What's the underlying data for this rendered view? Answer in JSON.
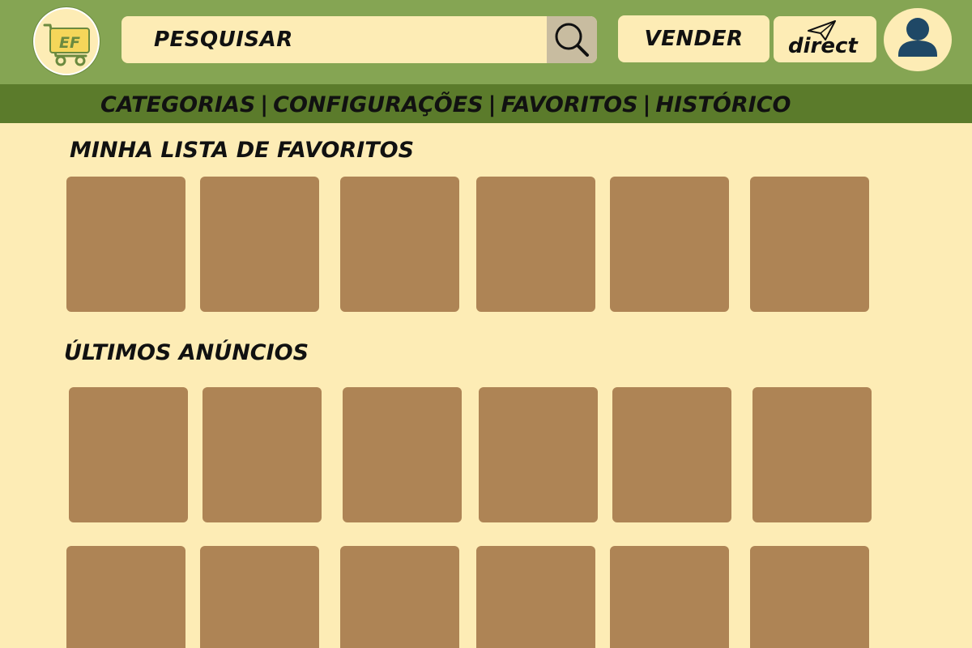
{
  "header": {
    "logo_icon": "cart-logo-icon",
    "logo_text": "EF",
    "search": {
      "placeholder": "PESQUISAR",
      "icon": "search-icon"
    },
    "sell_label": "VENDER",
    "direct_label": "direct",
    "direct_icon": "paper-plane-icon",
    "profile_icon": "user-icon"
  },
  "nav": {
    "items": [
      {
        "label": "CATEGORIAS"
      },
      {
        "label": "CONFIGURAÇÕES"
      },
      {
        "label": "FAVORITOS"
      },
      {
        "label": "HISTÓRICO"
      }
    ],
    "separator": "|"
  },
  "favorites": {
    "title": "MINHA LISTA DE FAVORITOS",
    "item_count": 6
  },
  "latest": {
    "title": "ÚLTIMOS ANÚNCIOS",
    "item_count": 12
  },
  "colors": {
    "header_bg": "#85a553",
    "nav_bg": "#5b7b2b",
    "page_bg": "#fdecb5",
    "card_bg": "#ae8455",
    "search_button_bg": "#c8bca0",
    "avatar": "#1f4866"
  }
}
